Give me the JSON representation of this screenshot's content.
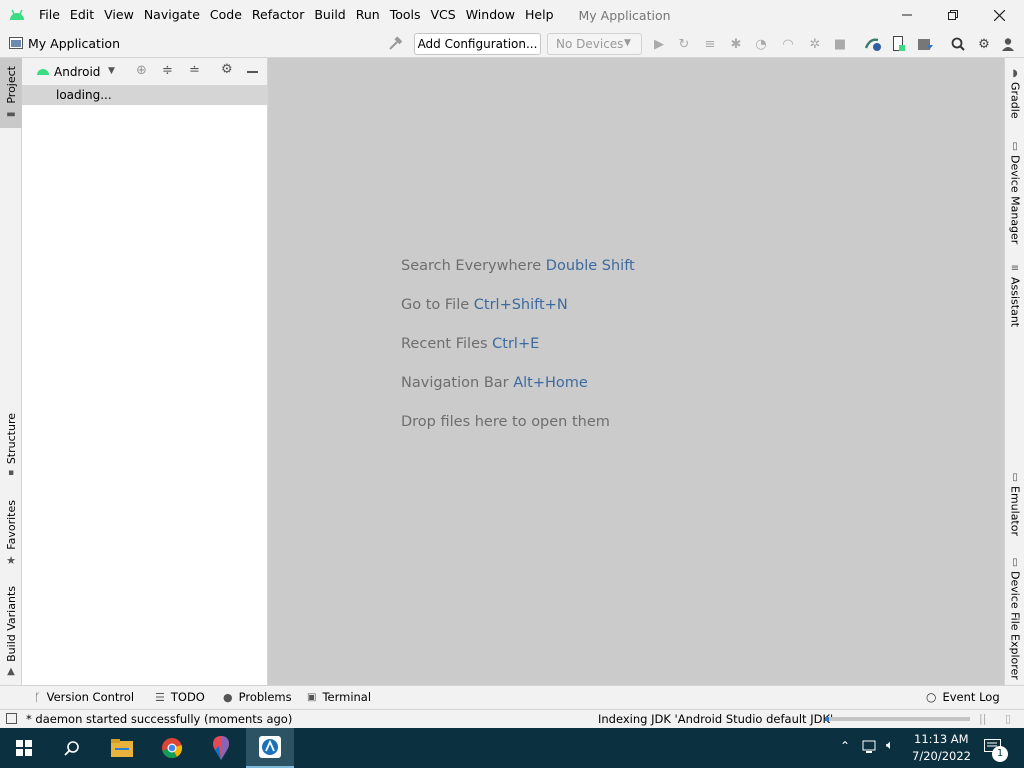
{
  "menubar": {
    "items": [
      "File",
      "Edit",
      "View",
      "Navigate",
      "Code",
      "Refactor",
      "Build",
      "Run",
      "Tools",
      "VCS",
      "Window",
      "Help"
    ],
    "app_title": "My Application"
  },
  "toolbar": {
    "project_name": "My Application",
    "add_configuration": "Add Configuration...",
    "devices": "No Devices"
  },
  "project_panel": {
    "view_mode": "Android",
    "loading": "loading..."
  },
  "left_tabs": {
    "project": "Project",
    "structure": "Structure",
    "favorites": "Favorites",
    "build_variants": "Build Variants"
  },
  "right_tabs": {
    "gradle": "Gradle",
    "device_manager": "Device Manager",
    "assistant": "Assistant",
    "emulator": "Emulator",
    "device_file_explorer": "Device File Explorer"
  },
  "editor_hints": [
    {
      "text": "Search Everywhere",
      "shortcut": "Double Shift"
    },
    {
      "text": "Go to File",
      "shortcut": "Ctrl+Shift+N"
    },
    {
      "text": "Recent Files",
      "shortcut": "Ctrl+E"
    },
    {
      "text": "Navigation Bar",
      "shortcut": "Alt+Home"
    },
    {
      "text": "Drop files here to open them",
      "shortcut": ""
    }
  ],
  "bottom_tools": {
    "version_control": "Version Control",
    "todo": "TODO",
    "problems": "Problems",
    "terminal": "Terminal",
    "event_log": "Event Log"
  },
  "status": {
    "message": "* daemon started successfully (moments ago)",
    "indexing": "Indexing JDK 'Android Studio default JDK'",
    "indexing_progress": 0.03
  },
  "taskbar": {
    "time": "11:13 AM",
    "date": "7/20/2022",
    "notification_count": "1"
  },
  "colors": {
    "android_green": "#3ddc84",
    "editor_bg": "#cbcbcb",
    "shortcut_blue": "#3d6a9e",
    "taskbar": "#0b3140"
  }
}
